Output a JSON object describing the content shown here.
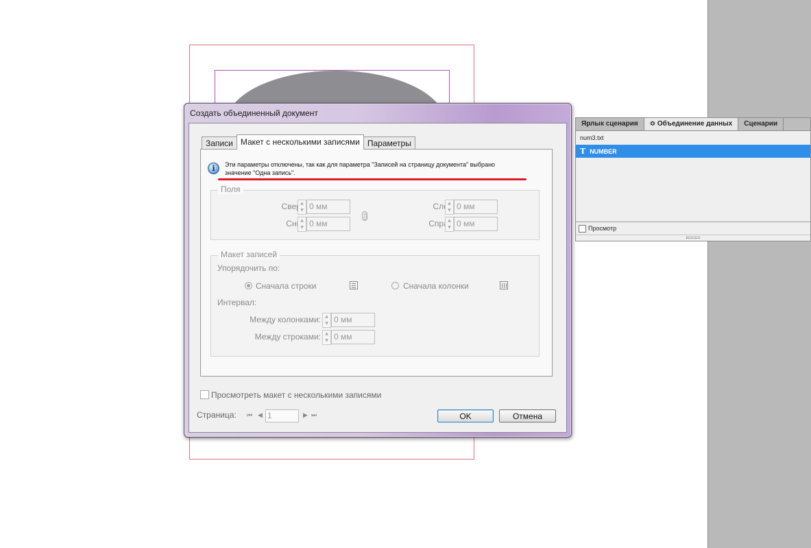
{
  "panel": {
    "tabs": [
      {
        "label": "Ярлык сценария"
      },
      {
        "label": "≎ Объединение данных"
      },
      {
        "label": "Сценарии"
      }
    ],
    "file_name": "num3.txt",
    "fields": [
      {
        "label": "NUMBER",
        "icon": "text-field-icon"
      }
    ],
    "preview_label": "Просмотр"
  },
  "dialog": {
    "title": "Создать объединенный документ",
    "tabs": [
      {
        "label": "Записи"
      },
      {
        "label": "Макет с несколькими записями"
      },
      {
        "label": "Параметры"
      }
    ],
    "info_line1": "Эти параметры отключены, так как для параметра \"Записей на страницу документа\" выбрано",
    "info_line2": "значение \"Одна запись\".",
    "margins": {
      "legend": "Поля",
      "top_label": "Сверху:",
      "top_value": "0 мм",
      "bottom_label": "Снизу:",
      "bottom_value": "0 мм",
      "left_label": "Слева:",
      "left_value": "0 мм",
      "right_label": "Справа:",
      "right_value": "0 мм"
    },
    "layout": {
      "legend": "Макет записей",
      "order_label": "Упорядочить по:",
      "rows_first": "Сначала строки",
      "columns_first": "Сначала колонки",
      "spacing_label": "Интервал:",
      "between_columns_label": "Между колонками:",
      "between_columns_value": "0 мм",
      "between_rows_label": "Между строками:",
      "between_rows_value": "0 мм"
    },
    "preview_multi": "Просмотреть макет с несколькими записями",
    "page_label": "Страница:",
    "page_value": "1",
    "ok": "OK",
    "cancel": "Отмена"
  },
  "colors": {
    "selection": "#2e8ee8",
    "annotation_red": "#e0192a"
  }
}
